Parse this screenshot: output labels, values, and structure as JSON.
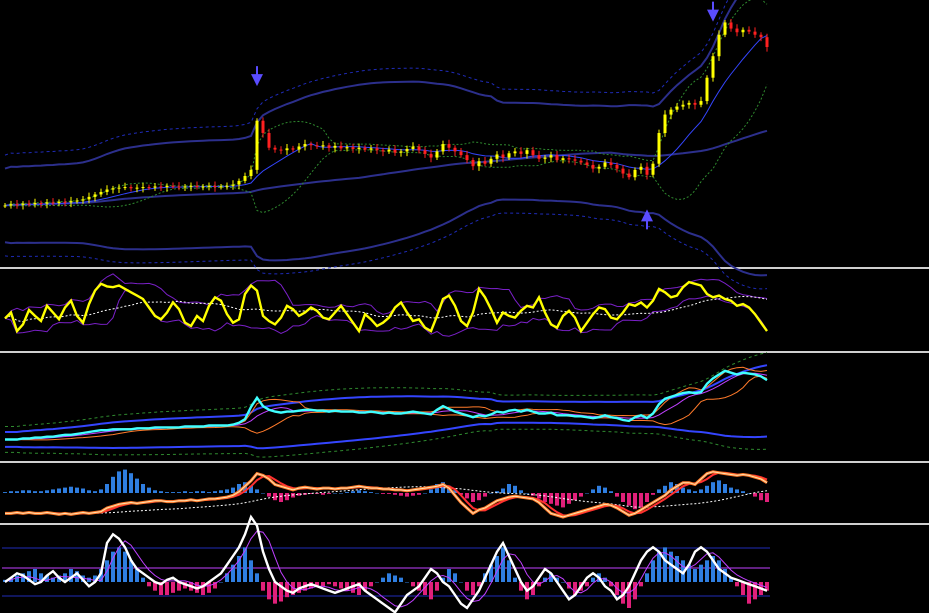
{
  "colors": {
    "background": "#000000",
    "separator": "#cfcfcf",
    "band_solid": "#2c2f8c",
    "band_dotted": "#1f2bb8",
    "envelope_green": "#2f8a2f",
    "candle_up": "#ffff00",
    "candle_down": "#ff2020",
    "ma_blue": "#3445ff",
    "arrow": "#5a4cff",
    "rsi_line": "#ffff00",
    "rsi_envelope": "#7a20c8",
    "cyan_line": "#40ffff",
    "orange_line": "#ff7a2a",
    "white_line": "#ffffff",
    "hist_pos": "#2f7ee0",
    "hist_neg": "#e0207a"
  },
  "chart_data": [
    {
      "type": "candlestick",
      "panel": "price",
      "bars": 128,
      "close": [
        25.2,
        25.4,
        25.3,
        25.5,
        25.4,
        25.6,
        25.5,
        25.7,
        25.6,
        25.8,
        25.7,
        25.9,
        26.0,
        26.2,
        26.6,
        27.0,
        27.4,
        27.8,
        28.0,
        28.1,
        28.2,
        28.0,
        28.1,
        28.2,
        28.1,
        28.3,
        28.2,
        28.4,
        28.3,
        28.2,
        28.3,
        28.4,
        28.2,
        28.3,
        28.4,
        28.2,
        28.3,
        28.4,
        28.6,
        29.2,
        30.0,
        31.0,
        39.0,
        37.0,
        34.6,
        34.3,
        34.2,
        34.5,
        34.3,
        34.8,
        35.2,
        35.0,
        34.8,
        35.0,
        34.6,
        34.9,
        34.5,
        34.7,
        34.4,
        34.6,
        34.3,
        34.5,
        34.2,
        34.0,
        34.3,
        33.8,
        34.0,
        34.4,
        34.8,
        34.2,
        33.6,
        33.0,
        34.0,
        35.2,
        34.6,
        34.0,
        33.4,
        32.6,
        31.6,
        32.4,
        32.0,
        32.8,
        33.5,
        33.0,
        33.7,
        34.0,
        33.6,
        34.2,
        33.4,
        32.8,
        33.0,
        33.4,
        32.6,
        32.9,
        32.7,
        32.5,
        32.2,
        31.8,
        31.2,
        31.5,
        32.2,
        31.8,
        31.2,
        30.4,
        29.8,
        31.0,
        31.5,
        30.2,
        32.0,
        37.0,
        40.0,
        40.8,
        41.3,
        41.6,
        41.9,
        41.6,
        42.2,
        46.0,
        49.5,
        53.0,
        55.0,
        54.0,
        53.4,
        53.8,
        53.5,
        53.0,
        52.6,
        51.0
      ],
      "signals": [
        {
          "type": "sell",
          "bar": 42
        },
        {
          "type": "buy",
          "bar": 107
        },
        {
          "type": "sell",
          "bar": 118
        }
      ]
    },
    {
      "type": "line",
      "panel": "rsi",
      "series": [
        {
          "values": [
            45,
            52,
            30,
            38,
            55,
            48,
            42,
            60,
            52,
            44,
            58,
            66,
            48,
            40,
            62,
            78,
            86,
            83,
            82,
            84,
            80,
            76,
            72,
            68,
            58,
            48,
            44,
            52,
            64,
            56,
            40,
            36,
            48,
            42,
            60,
            70,
            66,
            50,
            40,
            44,
            74,
            84,
            78,
            48,
            42,
            38,
            46,
            60,
            56,
            48,
            52,
            58,
            54,
            46,
            44,
            52,
            60,
            50,
            40,
            30,
            50,
            44,
            36,
            40,
            46,
            58,
            64,
            52,
            42,
            44,
            34,
            30,
            48,
            68,
            72,
            60,
            42,
            36,
            52,
            80,
            70,
            56,
            40,
            52,
            48,
            46,
            54,
            60,
            58,
            70,
            52,
            38,
            34,
            48,
            54,
            46,
            30,
            40,
            50,
            58,
            56,
            46,
            44,
            52,
            62,
            60,
            64,
            58,
            66,
            80,
            76,
            70,
            72,
            82,
            88,
            86,
            84,
            74,
            70,
            72,
            68,
            66,
            60,
            62,
            58,
            50,
            40,
            30
          ]
        }
      ]
    },
    {
      "type": "line",
      "panel": "cyan-oscillator",
      "series": [
        {
          "values": [
            20,
            20,
            20,
            21,
            21,
            22,
            22,
            23,
            23,
            24,
            25,
            25,
            26,
            27,
            28,
            29,
            30,
            30,
            31,
            31,
            31,
            31,
            32,
            32,
            32,
            33,
            33,
            33,
            33,
            33,
            34,
            34,
            34,
            34,
            35,
            35,
            35,
            35,
            36,
            38,
            42,
            55,
            65,
            56,
            52,
            50,
            49,
            50,
            50,
            51,
            52,
            52,
            51,
            51,
            50,
            51,
            50,
            50,
            50,
            49,
            49,
            50,
            49,
            48,
            49,
            48,
            48,
            49,
            50,
            49,
            48,
            47,
            52,
            56,
            53,
            50,
            48,
            46,
            44,
            46,
            45,
            47,
            50,
            49,
            51,
            52,
            50,
            52,
            50,
            48,
            48,
            49,
            46,
            46,
            46,
            45,
            45,
            44,
            43,
            44,
            46,
            44,
            43,
            41,
            40,
            44,
            46,
            43,
            48,
            58,
            64,
            66,
            68,
            70,
            71,
            70,
            71,
            80,
            86,
            90,
            94,
            92,
            90,
            92,
            91,
            90,
            88,
            84
          ]
        }
      ]
    },
    {
      "type": "bar+line",
      "panel": "histogram-orange",
      "bars": [
        1,
        2,
        2,
        3,
        3,
        2,
        2,
        3,
        4,
        5,
        6,
        7,
        6,
        5,
        3,
        2,
        4,
        10,
        18,
        24,
        26,
        22,
        16,
        10,
        6,
        3,
        2,
        1,
        1,
        1,
        2,
        1,
        2,
        2,
        1,
        2,
        3,
        4,
        6,
        10,
        12,
        8,
        4,
        0,
        -4,
        -8,
        -10,
        -8,
        -5,
        -3,
        -2,
        -1,
        -1,
        -2,
        -1,
        0,
        0,
        1,
        2,
        3,
        2,
        1,
        0,
        -1,
        -1,
        -2,
        -3,
        -4,
        -3,
        -2,
        0,
        4,
        10,
        12,
        8,
        3,
        -2,
        -6,
        -10,
        -8,
        -4,
        0,
        2,
        5,
        10,
        8,
        3,
        0,
        -3,
        -6,
        -10,
        -12,
        -14,
        -16,
        -12,
        -8,
        -4,
        0,
        4,
        8,
        6,
        2,
        -4,
        -10,
        -14,
        -18,
        -16,
        -10,
        -2,
        4,
        8,
        12,
        10,
        6,
        4,
        2,
        4,
        8,
        12,
        14,
        10,
        6,
        4,
        2,
        0,
        -4,
        -8,
        -10
      ],
      "series": [
        {
          "values": [
            -10,
            -10,
            -9,
            -10,
            -9,
            -10,
            -10,
            -9,
            -10,
            -11,
            -10,
            -11,
            -10,
            -9,
            -10,
            -9,
            -8,
            -4,
            -2,
            0,
            1,
            2,
            1,
            2,
            3,
            4,
            4,
            3,
            3,
            4,
            4,
            5,
            4,
            5,
            6,
            6,
            7,
            8,
            10,
            14,
            20,
            26,
            34,
            32,
            28,
            22,
            20,
            18,
            16,
            18,
            19,
            18,
            17,
            18,
            18,
            17,
            18,
            18,
            19,
            20,
            19,
            18,
            18,
            17,
            17,
            16,
            16,
            15,
            16,
            17,
            18,
            19,
            20,
            22,
            18,
            10,
            2,
            -4,
            -10,
            -6,
            -4,
            0,
            4,
            6,
            8,
            9,
            8,
            7,
            6,
            2,
            -4,
            -10,
            -12,
            -14,
            -12,
            -10,
            -8,
            -6,
            -4,
            -2,
            0,
            -1,
            -4,
            -8,
            -12,
            -10,
            -6,
            -2,
            2,
            6,
            10,
            16,
            20,
            24,
            24,
            22,
            28,
            34,
            36,
            35,
            34,
            33,
            32,
            33,
            32,
            30,
            28,
            24
          ]
        }
      ]
    },
    {
      "type": "bar+line",
      "panel": "histogram-white",
      "bars": [
        1,
        2,
        3,
        4,
        5,
        6,
        4,
        3,
        2,
        3,
        4,
        6,
        5,
        3,
        2,
        3,
        6,
        10,
        14,
        16,
        14,
        10,
        6,
        2,
        -2,
        -4,
        -6,
        -6,
        -5,
        -4,
        -3,
        -4,
        -5,
        -6,
        -5,
        -3,
        0,
        4,
        8,
        12,
        16,
        10,
        4,
        -4,
        -8,
        -10,
        -9,
        -7,
        -6,
        -5,
        -4,
        -3,
        -2,
        -2,
        -1,
        -2,
        -3,
        -4,
        -5,
        -6,
        -4,
        -2,
        0,
        2,
        4,
        3,
        2,
        0,
        -2,
        -4,
        -6,
        -8,
        -4,
        2,
        6,
        4,
        0,
        -4,
        -6,
        -2,
        4,
        8,
        12,
        16,
        10,
        2,
        -4,
        -8,
        -6,
        -2,
        2,
        4,
        2,
        0,
        -3,
        -6,
        -4,
        -2,
        2,
        4,
        2,
        -2,
        -6,
        -10,
        -12,
        -8,
        -2,
        4,
        10,
        14,
        16,
        14,
        12,
        10,
        8,
        6,
        8,
        10,
        12,
        10,
        6,
        2,
        -2,
        -6,
        -10,
        -8,
        -6,
        -4
      ],
      "series": [
        {
          "values": [
            0,
            2,
            4,
            3,
            1,
            -1,
            0,
            3,
            5,
            2,
            0,
            2,
            4,
            1,
            -2,
            0,
            4,
            18,
            22,
            20,
            16,
            10,
            6,
            4,
            2,
            0,
            -1,
            1,
            2,
            0,
            -1,
            -2,
            -3,
            -2,
            0,
            2,
            4,
            8,
            12,
            16,
            22,
            30,
            26,
            14,
            6,
            0,
            -2,
            -4,
            -5,
            -3,
            -2,
            -1,
            -2,
            -3,
            -4,
            -5,
            -4,
            -3,
            -2,
            -1,
            -4,
            -6,
            -8,
            -10,
            -12,
            -14,
            -10,
            -6,
            -4,
            -2,
            2,
            6,
            4,
            0,
            -2,
            -6,
            -10,
            -12,
            -8,
            -4,
            2,
            8,
            14,
            18,
            12,
            6,
            0,
            -4,
            -2,
            2,
            6,
            4,
            0,
            -4,
            -8,
            -6,
            -2,
            2,
            4,
            2,
            -2,
            -4,
            -8,
            -6,
            -2,
            4,
            10,
            14,
            16,
            14,
            10,
            8,
            6,
            4,
            8,
            14,
            16,
            14,
            10,
            6,
            4,
            2,
            1,
            0,
            -1,
            -2,
            -3,
            -4
          ]
        }
      ]
    }
  ]
}
